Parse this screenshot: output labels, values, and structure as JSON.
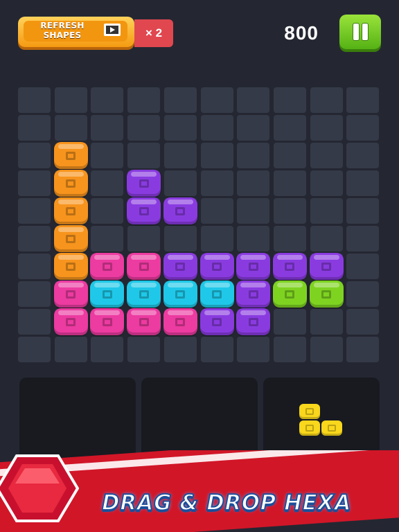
{
  "topbar": {
    "refresh_label_line1": "REFRESH",
    "refresh_label_line2": "SHAPES",
    "refresh_count": "× 2",
    "score": "800"
  },
  "colors": {
    "orange": "#f7941d",
    "pink": "#ec3ba1",
    "purple": "#8a3be0",
    "cyan": "#1fc8e8",
    "lime": "#7ed321",
    "yellow": "#f8d71c",
    "board_bg": "#242732",
    "cell": "#353a48"
  },
  "board": {
    "columns": 10,
    "rows": 10,
    "filled_cells": [
      {
        "r": 2,
        "c": 1,
        "color": "orange"
      },
      {
        "r": 3,
        "c": 1,
        "color": "orange"
      },
      {
        "r": 4,
        "c": 1,
        "color": "orange"
      },
      {
        "r": 5,
        "c": 1,
        "color": "orange"
      },
      {
        "r": 6,
        "c": 1,
        "color": "orange"
      },
      {
        "r": 3,
        "c": 3,
        "color": "purple"
      },
      {
        "r": 4,
        "c": 3,
        "color": "purple"
      },
      {
        "r": 4,
        "c": 4,
        "color": "purple"
      },
      {
        "r": 6,
        "c": 2,
        "color": "pink"
      },
      {
        "r": 6,
        "c": 3,
        "color": "pink"
      },
      {
        "r": 6,
        "c": 4,
        "color": "purple"
      },
      {
        "r": 6,
        "c": 5,
        "color": "purple"
      },
      {
        "r": 6,
        "c": 6,
        "color": "purple"
      },
      {
        "r": 6,
        "c": 7,
        "color": "purple"
      },
      {
        "r": 6,
        "c": 8,
        "color": "purple"
      },
      {
        "r": 7,
        "c": 1,
        "color": "pink"
      },
      {
        "r": 7,
        "c": 2,
        "color": "cyan"
      },
      {
        "r": 7,
        "c": 3,
        "color": "cyan"
      },
      {
        "r": 7,
        "c": 4,
        "color": "cyan"
      },
      {
        "r": 7,
        "c": 5,
        "color": "cyan"
      },
      {
        "r": 7,
        "c": 6,
        "color": "purple"
      },
      {
        "r": 7,
        "c": 7,
        "color": "lime"
      },
      {
        "r": 7,
        "c": 8,
        "color": "lime"
      },
      {
        "r": 8,
        "c": 1,
        "color": "pink"
      },
      {
        "r": 8,
        "c": 2,
        "color": "pink"
      },
      {
        "r": 8,
        "c": 3,
        "color": "pink"
      },
      {
        "r": 8,
        "c": 4,
        "color": "pink"
      },
      {
        "r": 8,
        "c": 5,
        "color": "purple"
      },
      {
        "r": 8,
        "c": 6,
        "color": "purple"
      }
    ]
  },
  "tray": {
    "slots": [
      {
        "name": "tray-slot-1",
        "piece": null
      },
      {
        "name": "tray-slot-2",
        "piece": null
      },
      {
        "name": "tray-slot-3",
        "piece": {
          "color": "yellow",
          "cells": [
            [
              0,
              0
            ],
            [
              1,
              0
            ],
            [
              1,
              1
            ]
          ]
        }
      }
    ]
  },
  "banner": {
    "title": "DRAG & DROP HEXA"
  }
}
